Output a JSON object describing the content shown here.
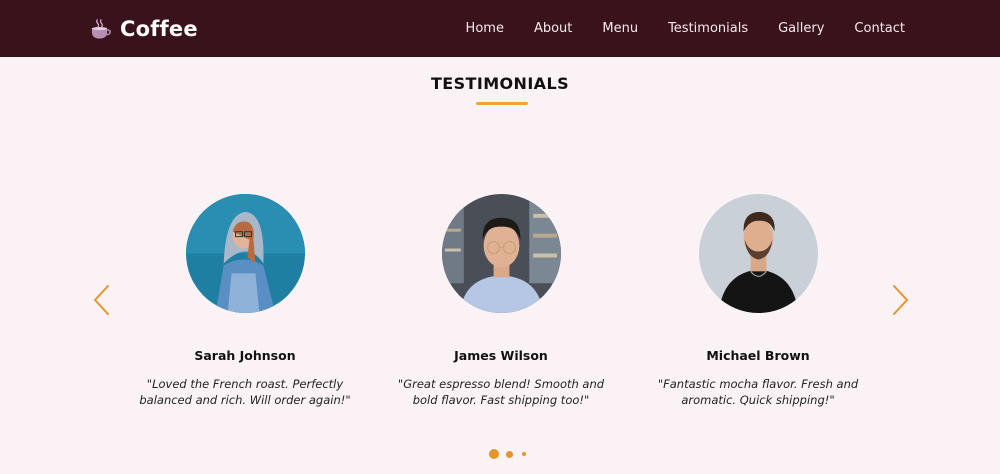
{
  "navbar": {
    "brand": "Coffee",
    "brand_icon": "coffee-cup-icon",
    "links": [
      {
        "label": "Home"
      },
      {
        "label": "About"
      },
      {
        "label": "Menu"
      },
      {
        "label": "Testimonials"
      },
      {
        "label": "Gallery"
      },
      {
        "label": "Contact"
      }
    ],
    "background": "#3a121c"
  },
  "section": {
    "title": "TESTIMONIALS",
    "accent_color": "#f0a23b"
  },
  "carousel": {
    "prev_icon": "chevron-left-icon",
    "next_icon": "chevron-right-icon",
    "testimonials": [
      {
        "name": "Sarah Johnson",
        "quote": "\"Loved the French roast. Perfectly balanced and rich. Will order again!\""
      },
      {
        "name": "James Wilson",
        "quote": "\"Great espresso blend! Smooth and bold flavor. Fast shipping too!\""
      },
      {
        "name": "Michael Brown",
        "quote": "\"Fantastic mocha flavor. Fresh and aromatic. Quick shipping!\""
      }
    ],
    "dots": 3,
    "active_dot": 1
  }
}
